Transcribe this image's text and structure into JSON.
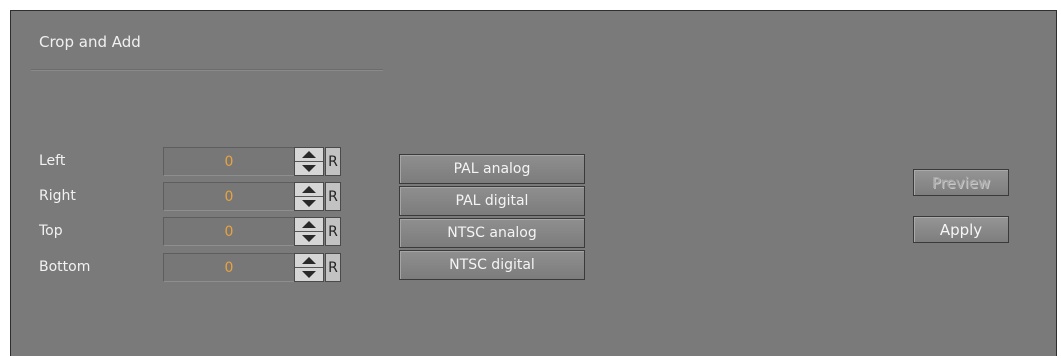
{
  "panel": {
    "title": "Crop and Add"
  },
  "crop_rows": [
    {
      "label": "Left",
      "value": "0",
      "reset": "R"
    },
    {
      "label": "Right",
      "value": "0",
      "reset": "R"
    },
    {
      "label": "Top",
      "value": "0",
      "reset": "R"
    },
    {
      "label": "Bottom",
      "value": "0",
      "reset": "R"
    }
  ],
  "presets": [
    {
      "label": "PAL analog"
    },
    {
      "label": "PAL digital"
    },
    {
      "label": "NTSC analog"
    },
    {
      "label": "NTSC digital"
    }
  ],
  "actions": {
    "preview_label": "Preview",
    "preview_enabled": false,
    "apply_label": "Apply",
    "apply_enabled": true
  },
  "colors": {
    "panel_bg": "#7a7a7a",
    "value_text": "#e8a33e",
    "label_text": "#f2f2f2"
  }
}
